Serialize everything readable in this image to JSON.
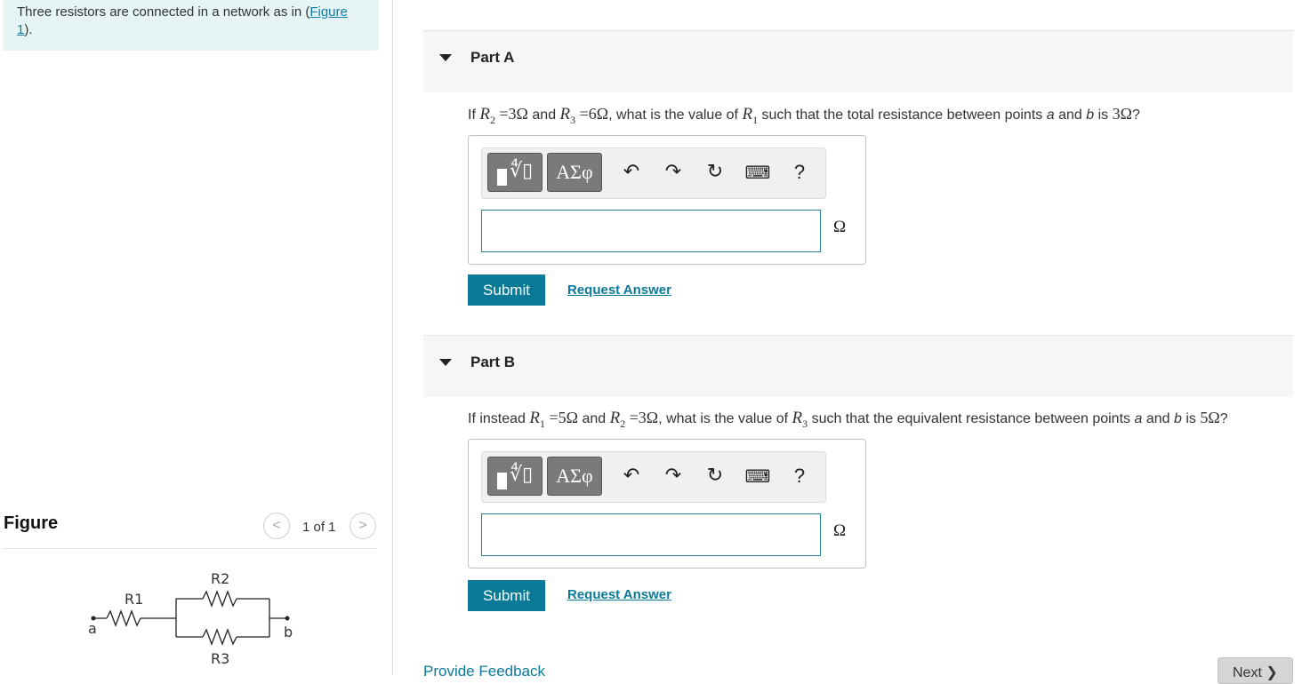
{
  "intro": {
    "text_before": "Three resistors are connected in a network as in (",
    "link": "Figure 1",
    "text_after": ")."
  },
  "figure": {
    "title": "Figure",
    "pager": "1 of 1",
    "prev_icon": "chevron-left-icon",
    "next_icon": "chevron-right-icon",
    "labels": {
      "r1": "R1",
      "r2": "R2",
      "r3": "R3",
      "a": "a",
      "b": "b"
    }
  },
  "toolbar": {
    "greek_label": "ΑΣφ",
    "help_label": "?",
    "icons": [
      "templates-icon",
      "greek-symbols-icon",
      "undo-icon",
      "redo-icon",
      "reset-icon",
      "keyboard-icon",
      "help-icon"
    ]
  },
  "part_a": {
    "title": "Part A",
    "q_if": "If",
    "r2_val": "=3Ω",
    "and1": "and",
    "r3_val": "=6Ω",
    "q_mid": ", what is the value of",
    "q_end_pre": "such that the total resistance between points",
    "a": "a",
    "and2": "and",
    "b": "b",
    "q_is": "is",
    "target": "3Ω",
    "q_mark": "?",
    "input_value": "",
    "unit": "Ω",
    "submit_label": "Submit",
    "request_label": "Request Answer"
  },
  "part_b": {
    "title": "Part B",
    "q_if": "If instead",
    "r1_val": "=5Ω",
    "and1": "and",
    "r2_val": "=3Ω",
    "q_mid": ", what is the value of",
    "q_end_pre": "such that the equivalent resistance between points",
    "a": "a",
    "and2": "and",
    "b": "b",
    "q_is": "is",
    "target": "5Ω",
    "q_mark": "?",
    "input_value": "",
    "unit": "Ω",
    "submit_label": "Submit",
    "request_label": "Request Answer"
  },
  "footer": {
    "feedback_label": "Provide Feedback",
    "next_label": "Next ❯"
  },
  "colors": {
    "accent": "#0b7a99",
    "intro_bg": "#e6f4f5"
  }
}
